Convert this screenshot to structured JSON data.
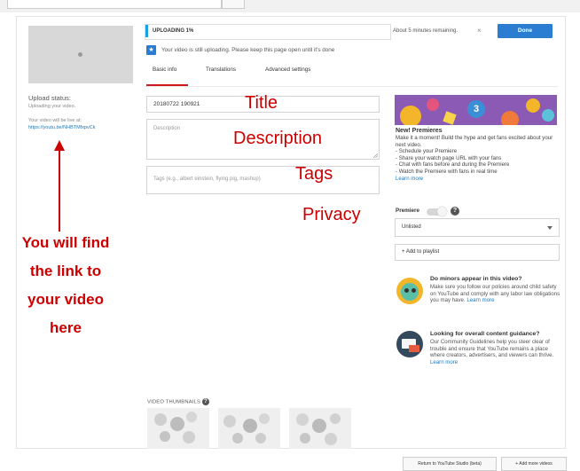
{
  "upload": {
    "progress_label": "UPLOADING 1%",
    "progress_value": 0.01,
    "remaining": "About 5 minutes remaining.",
    "close_glyph": "×",
    "done_label": "Done",
    "info_icon_glyph": "★",
    "info_message": "Your video is still uploading. Please keep this page open until it's done"
  },
  "left": {
    "status_title": "Upload status:",
    "status_text": "Uploading your video.",
    "live_text": "Your video will be live at:",
    "video_link": "https://youtu.be/NHBTMfxpvCk"
  },
  "tabs": [
    {
      "label": "Basic info"
    },
    {
      "label": "Translations"
    },
    {
      "label": "Advanced settings"
    }
  ],
  "form": {
    "title_value": "20180722 190921",
    "description_placeholder": "Description",
    "tags_placeholder": "Tags (e.g., albert einstein, flying pig, mashup)"
  },
  "annotations": {
    "title": "Title",
    "description": "Description",
    "tags": "Tags",
    "privacy": "Privacy",
    "link_note": [
      "You will find",
      "the link to",
      "your video",
      "here"
    ]
  },
  "premieres": {
    "banner_number": "3",
    "title": "New! Premieres",
    "intro": "Make it a moment! Build the hype and get fans excited about your next video.",
    "bullets": [
      "- Schedule your Premiere",
      "- Share your watch page URL with your fans",
      "- Chat with fans before and during the Premiere",
      "- Watch the Premiere with fans in real time"
    ],
    "learn_more": "Learn more",
    "premiere_label": "Premiere",
    "premiere_on": false,
    "help_glyph": "?"
  },
  "privacy": {
    "selected": "Unlisted",
    "add_playlist": "+ Add to playlist"
  },
  "tips": [
    {
      "title": "Do minors appear in this video?",
      "body": "Make sure you follow our policies around child safety on YouTube and comply with any labor law obligations you may have.",
      "link": "Learn more"
    },
    {
      "title": "Looking for overall content guidance?",
      "body": "Our Community Guidelines help you steer clear of trouble and ensure that YouTube remains a place where creators, advertisers, and viewers can thrive.",
      "link": "Learn more"
    }
  ],
  "thumbnails": {
    "label": "VIDEO THUMBNAILS",
    "help_glyph": "?"
  },
  "footer": {
    "return_label": "Return to YouTube Studio (beta)",
    "add_more_label": "+ Add more videos"
  },
  "colors": {
    "accent_blue": "#2a7dd1",
    "annotation_red": "#cc0000",
    "tab_red": "#cc181e",
    "link_blue": "#167ac6"
  }
}
